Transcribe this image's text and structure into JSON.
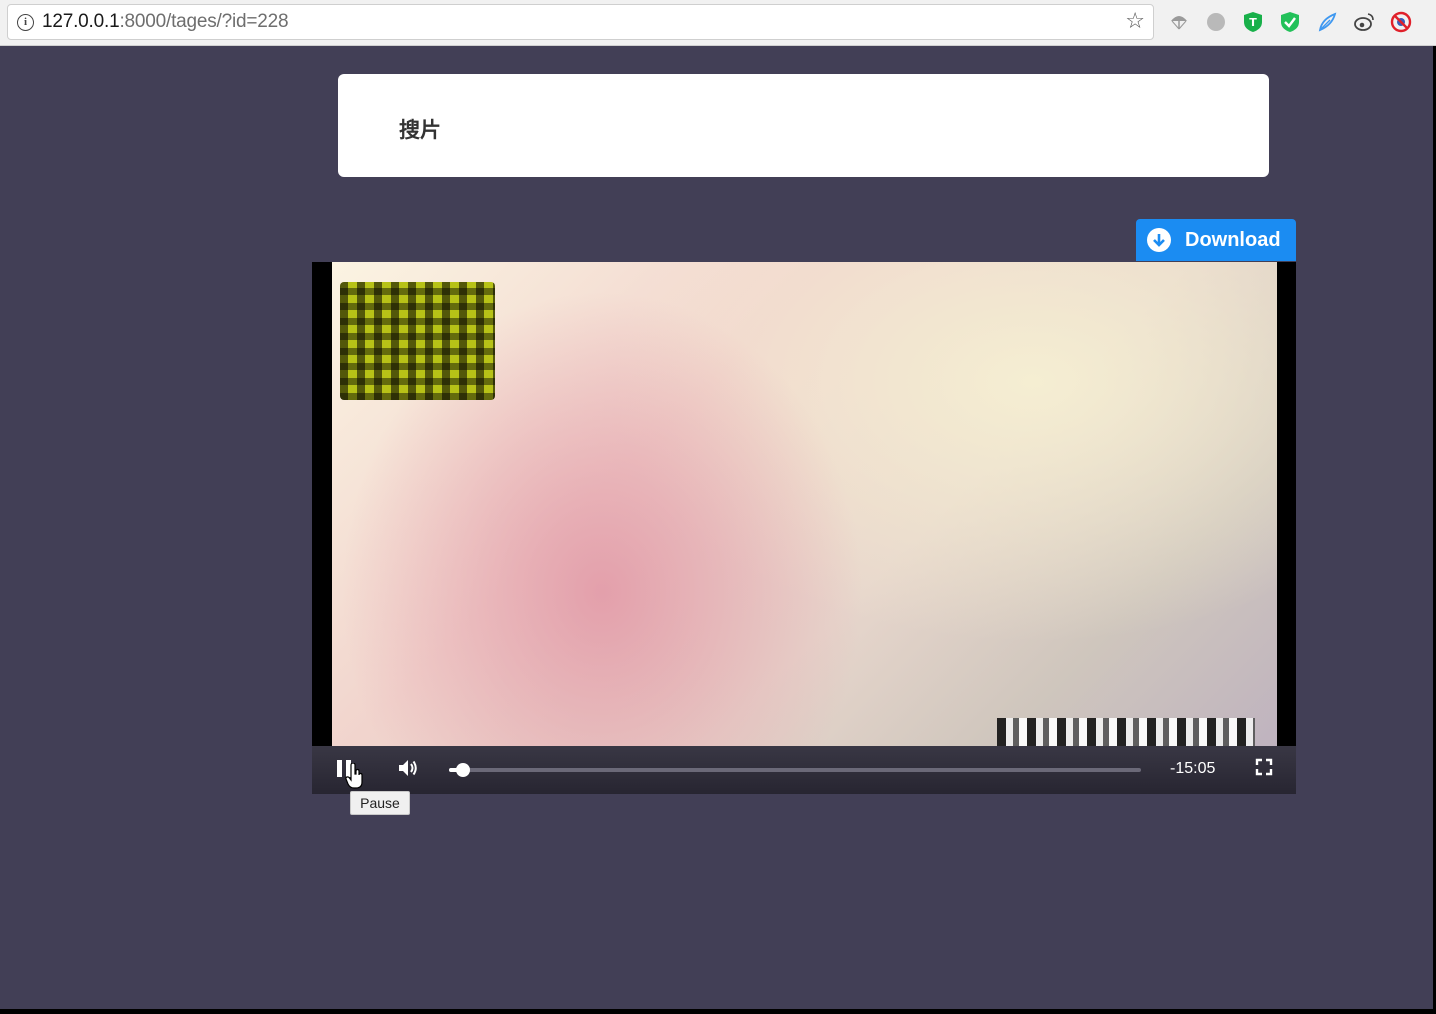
{
  "browser": {
    "url_host": "127.0.0.1",
    "url_path": ":8000/tages/?id=228",
    "extensions": [
      "parachute-icon",
      "circle-icon",
      "shield-t-icon",
      "shield-check-icon",
      "feather-icon",
      "weibo-icon",
      "blocker-icon"
    ]
  },
  "page": {
    "title": "搜片"
  },
  "download": {
    "label": "Download"
  },
  "player": {
    "time_remaining": "-15:05",
    "progress_fraction": 0.02,
    "tooltip": "Pause"
  },
  "colors": {
    "page_bg": "#423f56",
    "download_blue": "#1b8cf2"
  }
}
